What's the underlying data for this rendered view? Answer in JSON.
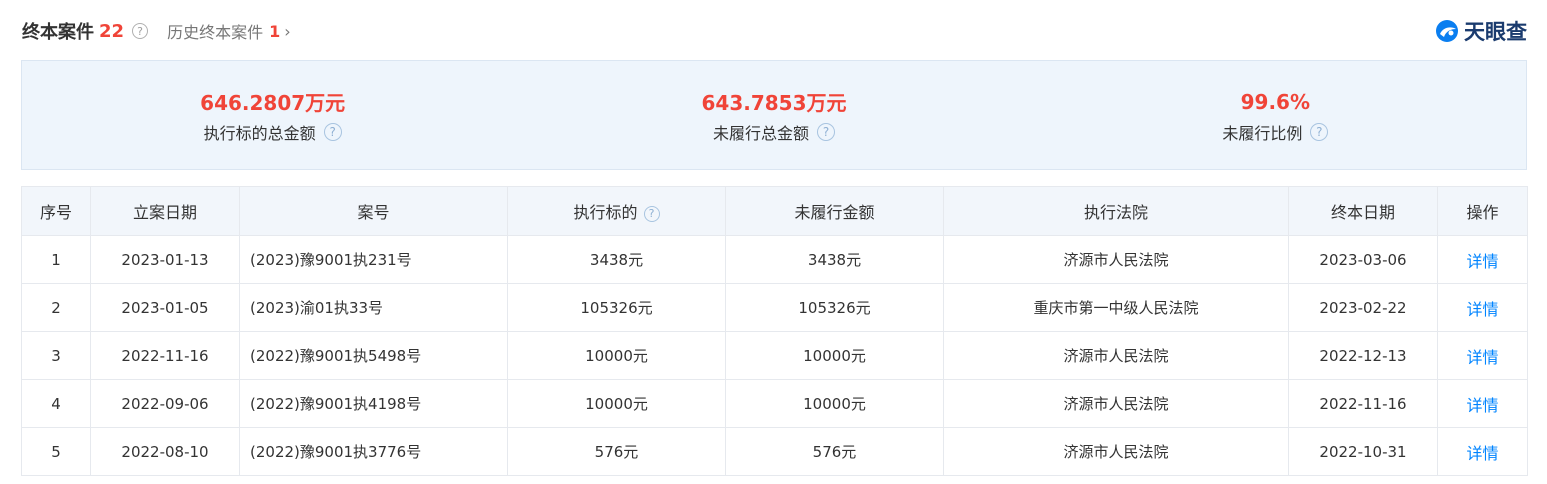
{
  "header": {
    "title": "终本案件",
    "count": "22",
    "history_label": "历史终本案件",
    "history_count": "1",
    "help_icon": "question-circle-icon"
  },
  "logo": {
    "text": "天眼查",
    "color": "#1a3b6e"
  },
  "summary": [
    {
      "value": "646.2807万元",
      "label": "执行标的总金额"
    },
    {
      "value": "643.7853万元",
      "label": "未履行总金额"
    },
    {
      "value": "99.6%",
      "label": "未履行比例"
    }
  ],
  "table": {
    "headers": [
      "序号",
      "立案日期",
      "案号",
      "执行标的",
      "未履行金额",
      "执行法院",
      "终本日期",
      "操作"
    ],
    "rows": [
      {
        "no": "1",
        "filed": "2023-01-13",
        "case": "(2023)豫9001执231号",
        "target": "3438元",
        "unpaid": "3438元",
        "court": "济源市人民法院",
        "ended": "2023-03-06",
        "action": "详情"
      },
      {
        "no": "2",
        "filed": "2023-01-05",
        "case": "(2023)渝01执33号",
        "target": "105326元",
        "unpaid": "105326元",
        "court": "重庆市第一中级人民法院",
        "ended": "2023-02-22",
        "action": "详情"
      },
      {
        "no": "3",
        "filed": "2022-11-16",
        "case": "(2022)豫9001执5498号",
        "target": "10000元",
        "unpaid": "10000元",
        "court": "济源市人民法院",
        "ended": "2022-12-13",
        "action": "详情"
      },
      {
        "no": "4",
        "filed": "2022-09-06",
        "case": "(2022)豫9001执4198号",
        "target": "10000元",
        "unpaid": "10000元",
        "court": "济源市人民法院",
        "ended": "2022-11-16",
        "action": "详情"
      },
      {
        "no": "5",
        "filed": "2022-08-10",
        "case": "(2022)豫9001执3776号",
        "target": "576元",
        "unpaid": "576元",
        "court": "济源市人民法院",
        "ended": "2022-10-31",
        "action": "详情"
      }
    ]
  },
  "colors": {
    "accent_red": "#f04438",
    "link_blue": "#0084ff",
    "summary_bg": "#eef5fc",
    "header_bg": "#f2f6fb"
  }
}
